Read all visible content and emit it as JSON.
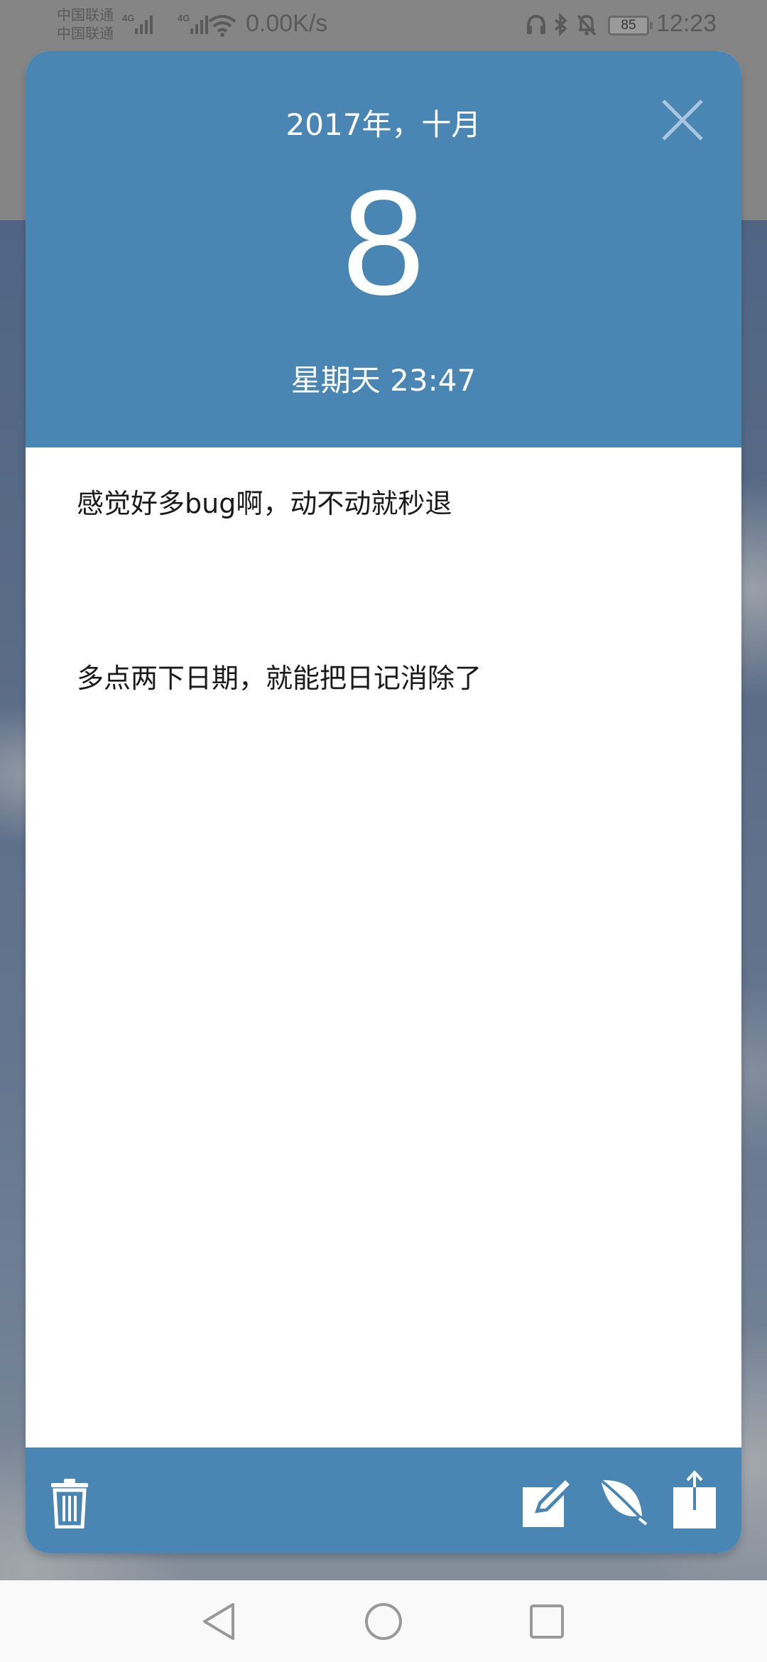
{
  "status_bar": {
    "carrier_1": "中国联通",
    "carrier_2": "中国联通",
    "network_1": "4G",
    "network_2": "4G",
    "net_speed": "0.00K/s",
    "battery": "85",
    "time": "12:23"
  },
  "entry": {
    "month_label": "2017年，十月",
    "day": "8",
    "weekday_time": "星期天 23:47",
    "lines": [
      "感觉好多bug啊，动不动就秒退",
      "多点两下日期，就能把日记消除了"
    ]
  },
  "icons": {
    "close": "close-icon",
    "delete": "trash-icon",
    "edit": "edit-icon",
    "theme": "leaf-icon",
    "share": "share-icon",
    "back": "back-triangle-icon",
    "home": "home-circle-icon",
    "recents": "recents-square-icon"
  },
  "colors": {
    "header": "#4a86b4",
    "body": "#ffffff",
    "text": "#1a1a1a"
  }
}
